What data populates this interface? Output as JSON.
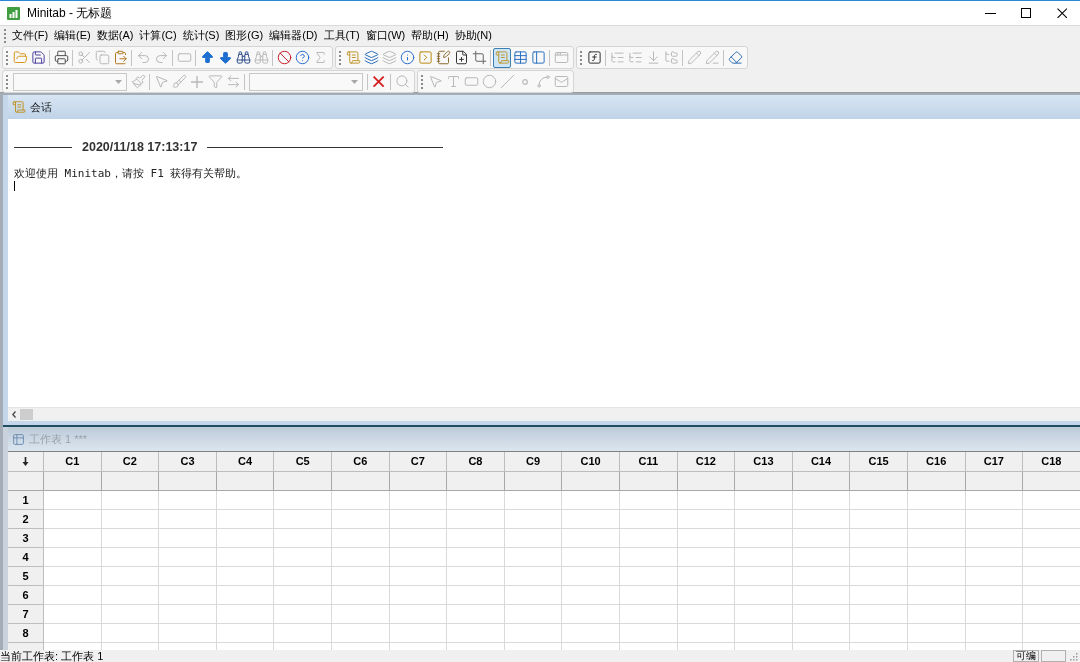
{
  "window": {
    "title": "Minitab - 无标题"
  },
  "menu": [
    "文件(F)",
    "编辑(E)",
    "数据(A)",
    "计算(C)",
    "统计(S)",
    "图形(G)",
    "编辑器(D)",
    "工具(T)",
    "窗口(W)",
    "帮助(H)",
    "协助(N)"
  ],
  "toolbar_rows": [
    [
      {
        "sections": [
          [
            {
              "kind": "button",
              "disabled": false,
              "pressed": false
            },
            {
              "kind": "button",
              "disabled": false,
              "pressed": false
            }
          ],
          [
            {
              "kind": "button",
              "disabled": false,
              "pressed": false
            }
          ],
          [
            {
              "kind": "button",
              "disabled": true,
              "pressed": false
            },
            {
              "kind": "button",
              "disabled": true,
              "pressed": false
            },
            {
              "kind": "button",
              "disabled": false,
              "pressed": false
            }
          ],
          [
            {
              "kind": "button",
              "disabled": true,
              "pressed": false
            },
            {
              "kind": "button",
              "disabled": true,
              "pressed": false
            }
          ],
          [
            {
              "kind": "button",
              "disabled": true,
              "pressed": false
            }
          ],
          [
            {
              "kind": "button",
              "disabled": false,
              "pressed": false
            },
            {
              "kind": "button",
              "disabled": false,
              "pressed": false
            },
            {
              "kind": "button",
              "disabled": false,
              "pressed": false
            },
            {
              "kind": "button",
              "disabled": true,
              "pressed": false
            }
          ],
          [
            {
              "kind": "button",
              "disabled": false,
              "pressed": false
            },
            {
              "kind": "button",
              "disabled": false,
              "pressed": false
            },
            {
              "kind": "button",
              "disabled": true,
              "pressed": false
            }
          ]
        ]
      },
      {
        "sections": [
          [
            {
              "kind": "button",
              "disabled": false,
              "pressed": false
            },
            {
              "kind": "button",
              "disabled": false,
              "pressed": false
            },
            {
              "kind": "button",
              "disabled": true,
              "pressed": false
            },
            {
              "kind": "button",
              "disabled": false,
              "pressed": false
            },
            {
              "kind": "button",
              "disabled": false,
              "pressed": false
            },
            {
              "kind": "button",
              "disabled": false,
              "pressed": false
            },
            {
              "kind": "button",
              "disabled": false,
              "pressed": false
            },
            {
              "kind": "button",
              "disabled": false,
              "pressed": false
            }
          ],
          [
            {
              "kind": "button",
              "disabled": false,
              "pressed": true
            },
            {
              "kind": "button",
              "disabled": false,
              "pressed": false
            },
            {
              "kind": "button",
              "disabled": false,
              "pressed": false
            }
          ],
          [
            {
              "kind": "button",
              "disabled": true,
              "pressed": false
            }
          ]
        ]
      },
      {
        "sections": [
          [
            {
              "kind": "button",
              "disabled": false,
              "pressed": false
            }
          ],
          [
            {
              "kind": "button",
              "disabled": true,
              "pressed": false
            },
            {
              "kind": "button",
              "disabled": true,
              "pressed": false
            },
            {
              "kind": "button",
              "disabled": true,
              "pressed": false
            },
            {
              "kind": "button",
              "disabled": true,
              "pressed": false
            }
          ],
          [
            {
              "kind": "button",
              "disabled": true,
              "pressed": false
            },
            {
              "kind": "button",
              "disabled": true,
              "pressed": false
            }
          ],
          [
            {
              "kind": "button",
              "disabled": false,
              "pressed": false
            }
          ]
        ]
      }
    ],
    [
      {
        "sections": [
          [
            {
              "kind": "combo",
              "disabled": true
            },
            {
              "kind": "button",
              "disabled": true,
              "pressed": false
            }
          ],
          [
            {
              "kind": "button",
              "disabled": true,
              "pressed": false
            },
            {
              "kind": "button",
              "disabled": true,
              "pressed": false
            },
            {
              "kind": "button",
              "disabled": true,
              "pressed": false
            },
            {
              "kind": "button",
              "disabled": true,
              "pressed": false
            },
            {
              "kind": "button",
              "disabled": true,
              "pressed": false
            }
          ],
          [
            {
              "kind": "combo",
              "disabled": true
            }
          ],
          [
            {
              "kind": "button",
              "disabled": false,
              "pressed": false
            }
          ],
          [
            {
              "kind": "button",
              "disabled": true,
              "pressed": false
            }
          ]
        ]
      },
      {
        "sections": [
          [
            {
              "kind": "button",
              "disabled": true,
              "pressed": false
            },
            {
              "kind": "button",
              "disabled": true,
              "pressed": false
            },
            {
              "kind": "button",
              "disabled": true,
              "pressed": false
            },
            {
              "kind": "button",
              "disabled": true,
              "pressed": false
            },
            {
              "kind": "button",
              "disabled": true,
              "pressed": false
            },
            {
              "kind": "button",
              "disabled": true,
              "pressed": false
            },
            {
              "kind": "button",
              "disabled": true,
              "pressed": false
            },
            {
              "kind": "button",
              "disabled": true,
              "pressed": false
            }
          ]
        ]
      }
    ]
  ],
  "session": {
    "title": "会话",
    "active": true,
    "timestamp": "2020/11/18 17:13:17",
    "message": "欢迎使用 Minitab，请按 F1 获得有关帮助。"
  },
  "worksheet": {
    "title": "工作表 1 ***",
    "active": false,
    "columns": [
      "C1",
      "C2",
      "C3",
      "C4",
      "C5",
      "C6",
      "C7",
      "C8",
      "C9",
      "C10",
      "C11",
      "C12",
      "C13",
      "C14",
      "C15",
      "C16",
      "C17",
      "C18"
    ],
    "rows": [
      "1",
      "2",
      "3",
      "4",
      "5",
      "6",
      "7",
      "8"
    ]
  },
  "status_bar": {
    "text": "当前工作表: 工作表 1",
    "pane_1": "可编"
  }
}
